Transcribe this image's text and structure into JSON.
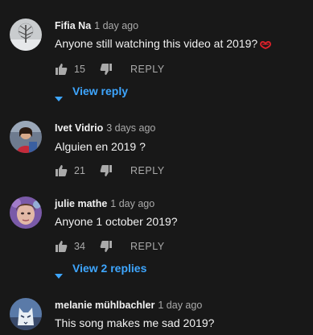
{
  "comments": [
    {
      "author": "Fifia Na",
      "time": "1 day ago",
      "text": "Anyone still watching this video at 2019?",
      "likes": "15",
      "reply_label": "REPLY",
      "view_replies": "View reply",
      "avatar_icon": "snowy-tree-avatar"
    },
    {
      "author": "Ivet Vidrio",
      "time": "3 days ago",
      "text": "Alguien en 2019 ?",
      "likes": "21",
      "reply_label": "REPLY",
      "avatar_icon": "person-avatar"
    },
    {
      "author": "julie mathe",
      "time": "1 day ago",
      "text": "Anyone 1 october 2019?",
      "likes": "34",
      "reply_label": "REPLY",
      "view_replies": "View 2 replies",
      "avatar_icon": "face-avatar"
    },
    {
      "author": "melanie mühlbachler",
      "time": "1 day ago",
      "text": "This song makes me sad 2019?",
      "avatar_icon": "wolf-avatar"
    }
  ],
  "colors": {
    "background": "#181818",
    "text_primary": "#f1f1f1",
    "text_secondary": "#aaaaaa",
    "link": "#3ea6ff",
    "heart": "#e0202a"
  }
}
